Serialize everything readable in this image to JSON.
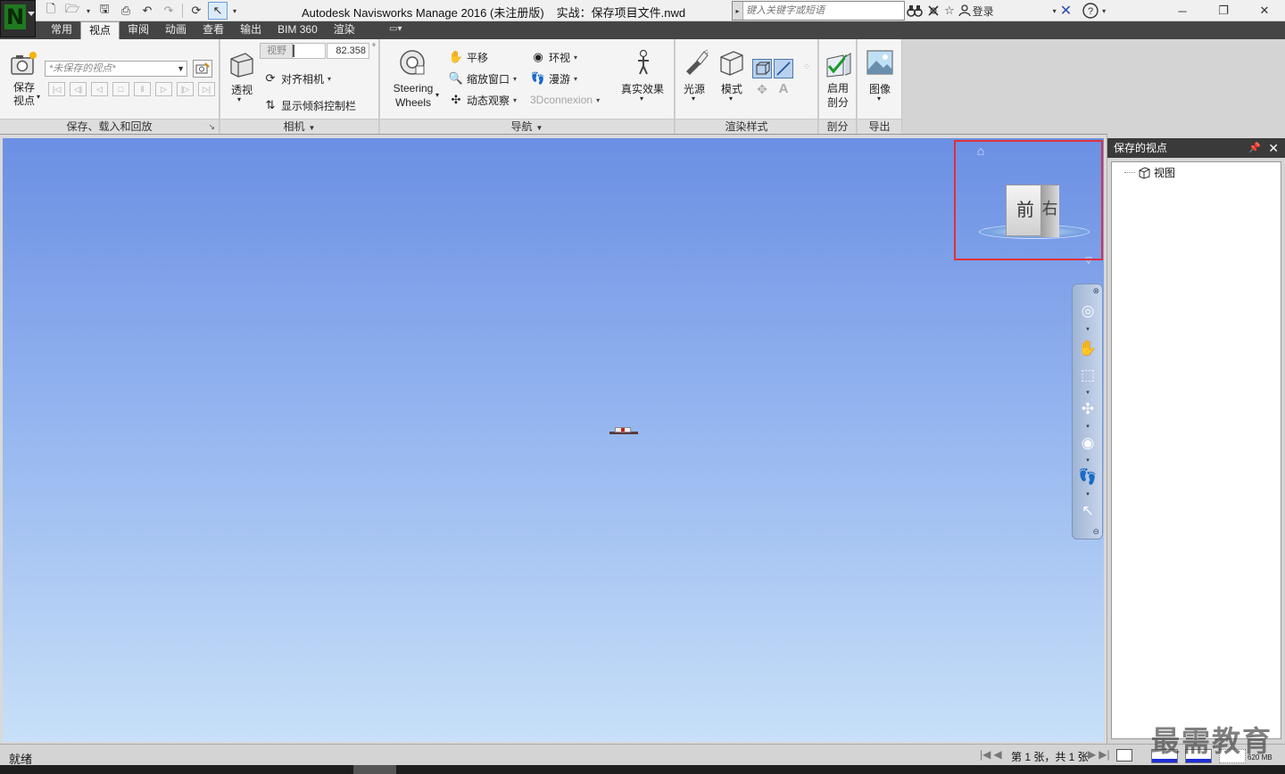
{
  "window": {
    "app_name": "Autodesk Navisworks Manage 2016 (未注册版)",
    "file_title": "实战：保存项目文件.nwd"
  },
  "search": {
    "placeholder": "键入关键字或短语"
  },
  "account": {
    "login_label": "登录"
  },
  "tabs": [
    {
      "label": "常用",
      "active": false
    },
    {
      "label": "视点",
      "active": true
    },
    {
      "label": "审阅",
      "active": false
    },
    {
      "label": "动画",
      "active": false
    },
    {
      "label": "查看",
      "active": false
    },
    {
      "label": "输出",
      "active": false
    },
    {
      "label": "BIM 360",
      "active": false
    },
    {
      "label": "渲染",
      "active": false
    }
  ],
  "ribbon": {
    "save_panel": {
      "title": "保存、载入和回放",
      "save_viewpoint_label": "保存\n视点",
      "viewpoint_combo_value": "*未保存的视点*"
    },
    "camera_panel": {
      "title": "相机",
      "perspective_label": "透视",
      "fov_label": "视野",
      "fov_value": "82.358",
      "fov_unit": "°",
      "align_camera_label": "对齐相机",
      "show_tilt_label": "显示倾斜控制栏"
    },
    "navigate_panel": {
      "title": "导航",
      "steering_wheels_label_1": "Steering",
      "steering_wheels_label_2": "Wheels",
      "pan_label": "平移",
      "zoom_window_label": "缩放窗口",
      "orbit_label": "动态观察",
      "look_around_label": "环视",
      "walk_label": "漫游",
      "connexion_label": "3Dconnexion",
      "realism_label": "真实效果"
    },
    "render_panel": {
      "title": "渲染样式",
      "light_label": "光源",
      "mode_label": "模式"
    },
    "sectioning_panel": {
      "title": "剖分",
      "enable_label_1": "启用",
      "enable_label_2": "剖分"
    },
    "export_panel": {
      "title": "导出",
      "image_label": "图像"
    }
  },
  "viewcube": {
    "front_label": "前",
    "right_label": "右"
  },
  "saved_viewpoints": {
    "title": "保存的视点",
    "items": [
      {
        "label": "视图"
      }
    ]
  },
  "status": {
    "ready_text": "就绪",
    "sheet_text": "第 1 张，共 1 张",
    "memory_text": "620 MB"
  },
  "watermark": {
    "text": "最需教育"
  },
  "colors": {
    "sky_top": "#6b8fe3",
    "sky_bottom": "#c8e0f8",
    "highlight": "#e0303a",
    "ribbon_bg": "#f4f4f4",
    "tab_bar": "#454545"
  }
}
